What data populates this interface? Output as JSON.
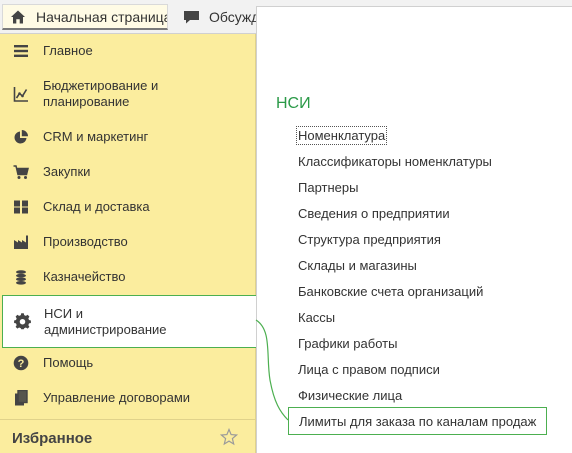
{
  "tabs": {
    "home": "Начальная страница",
    "discussions": "Обсужд"
  },
  "sidebar": {
    "items": [
      {
        "label": "Главное",
        "icon": "menu-lines-icon"
      },
      {
        "label": "Бюджетирование и\nпланирование",
        "icon": "chart-icon"
      },
      {
        "label": "CRM и маркетинг",
        "icon": "pie-chart-icon"
      },
      {
        "label": "Закупки",
        "icon": "cart-icon"
      },
      {
        "label": "Склад и доставка",
        "icon": "warehouse-grid-icon"
      },
      {
        "label": "Производство",
        "icon": "factory-icon"
      },
      {
        "label": "Казначейство",
        "icon": "coins-icon"
      },
      {
        "label": "НСИ и\nадминистрирование",
        "icon": "gear-icon"
      },
      {
        "label": "Помощь",
        "icon": "question-icon"
      },
      {
        "label": "Управление договорами",
        "icon": "documents-icon"
      }
    ],
    "favorites_label": "Избранное"
  },
  "section": {
    "title": "НСИ",
    "links": [
      "Номенклатура",
      "Классификаторы номенклатуры",
      "Партнеры",
      "Сведения о предприятии",
      "Структура предприятия",
      "Склады и магазины",
      "Банковские счета организаций",
      "Кассы",
      "Графики работы",
      "Лица с правом подписи",
      "Физические лица",
      "Лимиты для заказа по каналам продаж"
    ]
  },
  "colors": {
    "sidebar_bg": "#fbed9e",
    "accent_green": "#4caf50",
    "section_title": "#2b9a48",
    "tab_active_bg": "#fffbe5"
  }
}
